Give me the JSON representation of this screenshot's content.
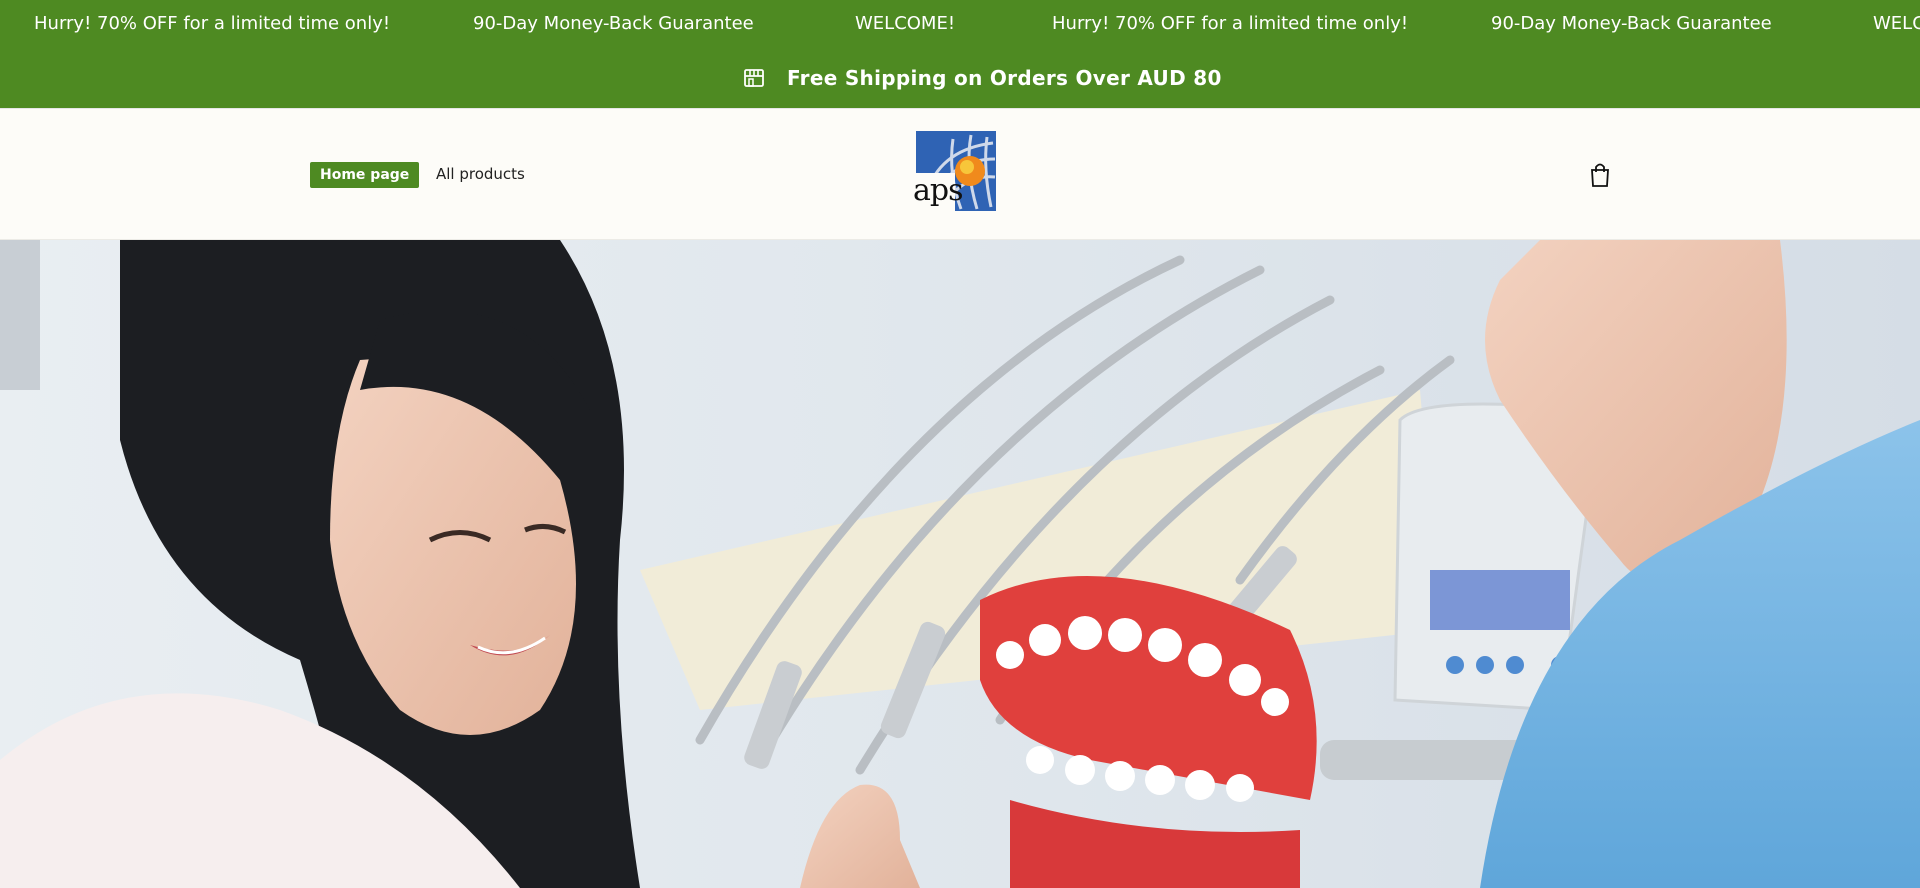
{
  "announcement": {
    "ticker_items": [
      "Hurry! 70% OFF for a limited time only!",
      "90-Day Money-Back Guarantee",
      "WELCOME!",
      "Hurry! 70% OFF for a limited time only!",
      "90-Day Money-Back Guarantee",
      "WELCOME!"
    ],
    "shipping_text": "Free Shipping on Orders Over AUD 80",
    "shipping_icon": "store-icon"
  },
  "header": {
    "nav": [
      {
        "label": "Home page",
        "active": true
      },
      {
        "label": "All products",
        "active": false
      }
    ],
    "logo_text": "aps",
    "cart_icon": "shopping-bag-icon"
  },
  "hero": {
    "image_subject": "dentist-showing-teeth-model-to-patient"
  },
  "colors": {
    "brand_green": "#4e8a22",
    "header_bg": "#fdfcf8",
    "logo_blue": "#2f63b4",
    "logo_orange": "#f08a1c"
  }
}
